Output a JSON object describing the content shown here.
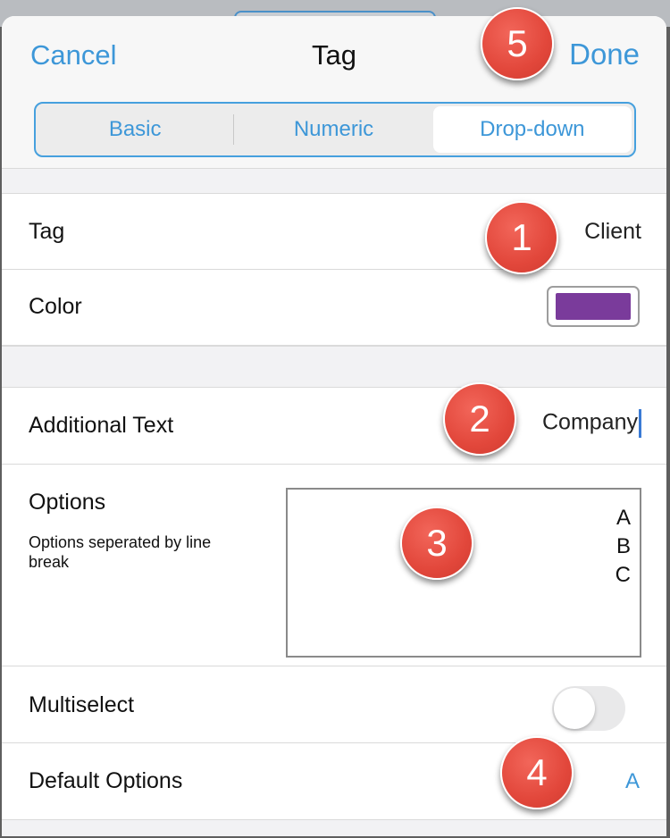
{
  "nav": {
    "cancel": "Cancel",
    "title": "Tag",
    "done": "Done"
  },
  "segments": [
    "Basic",
    "Numeric",
    "Drop-down"
  ],
  "selected_segment": "Drop-down",
  "tag": {
    "label": "Tag",
    "value": "Client"
  },
  "color": {
    "label": "Color",
    "swatch": "#7a3b9b"
  },
  "additional_text": {
    "label": "Additional Text",
    "value": "Company"
  },
  "options": {
    "label": "Options",
    "hint": "Options seperated by line break",
    "values": [
      "A",
      "B",
      "C"
    ]
  },
  "multiselect": {
    "label": "Multiselect",
    "enabled": false
  },
  "default_options": {
    "label": "Default Options",
    "value": "A"
  },
  "badges": [
    "1",
    "2",
    "3",
    "4",
    "5"
  ],
  "colors": {
    "accent": "#3d97d8",
    "badge": "#e2473b"
  }
}
